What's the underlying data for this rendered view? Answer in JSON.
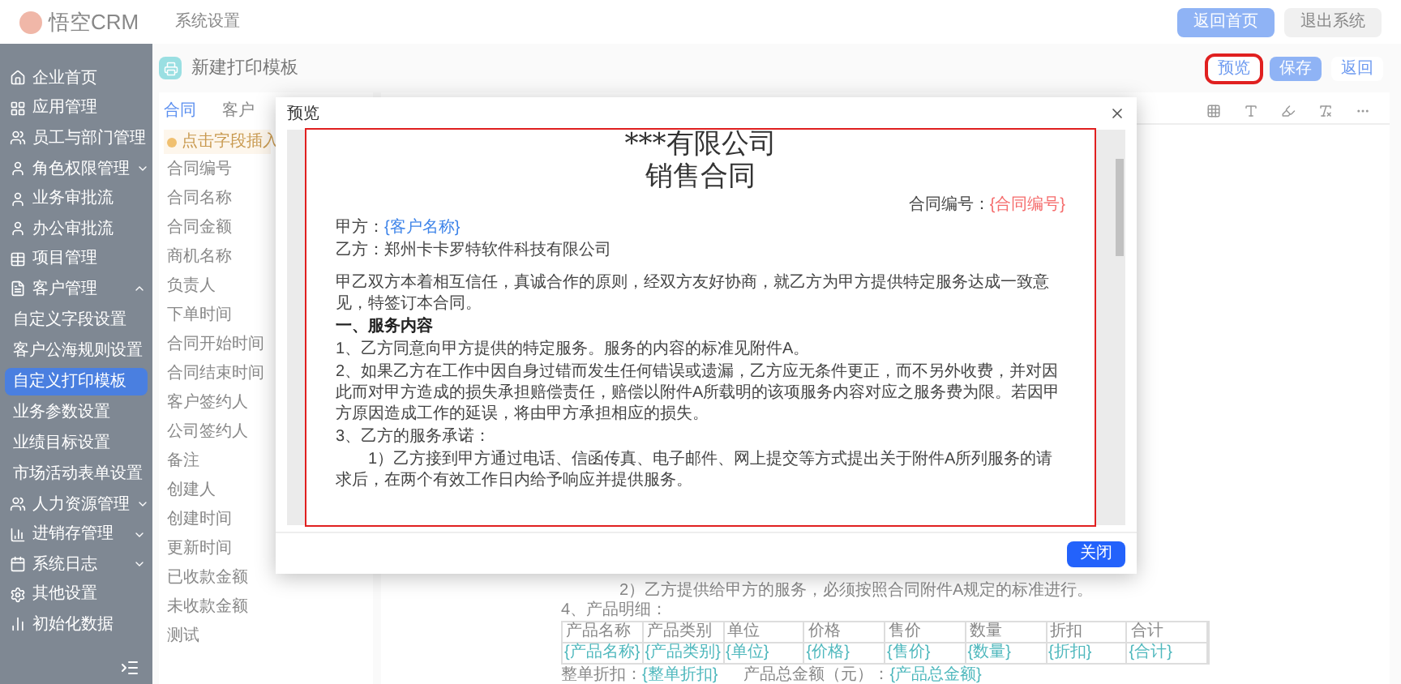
{
  "header": {
    "logo": "悟空CRM",
    "nav": "系统设置",
    "buttons": [
      {
        "label": "返回首页",
        "kind": "primary"
      },
      {
        "label": "退出系统",
        "kind": "default"
      }
    ]
  },
  "sidebar": {
    "items": [
      {
        "label": "企业首页"
      },
      {
        "label": "应用管理"
      },
      {
        "label": "员工与部门管理"
      },
      {
        "label": "角色权限管理",
        "expanded": false
      },
      {
        "label": "业务审批流"
      },
      {
        "label": "办公审批流"
      },
      {
        "label": "项目管理"
      },
      {
        "label": "客户管理",
        "expanded": true,
        "children": [
          {
            "label": "自定义字段设置",
            "selected": false
          },
          {
            "label": "客户公海规则设置",
            "selected": false
          },
          {
            "label": "自定义打印模板",
            "selected": true
          },
          {
            "label": "业务参数设置",
            "selected": false
          },
          {
            "label": "业绩目标设置",
            "selected": false
          },
          {
            "label": "市场活动表单设置",
            "selected": false
          }
        ]
      },
      {
        "label": "人力资源管理",
        "expanded": false
      },
      {
        "label": "进销存管理",
        "expanded": false
      },
      {
        "label": "系统日志",
        "expanded": false
      },
      {
        "label": "其他设置"
      },
      {
        "label": "初始化数据"
      }
    ]
  },
  "page": {
    "title": "新建打印模板",
    "buttons": [
      {
        "label": "预览",
        "kind": "default",
        "highlighted": true
      },
      {
        "label": "保存",
        "kind": "primary",
        "highlighted": false
      },
      {
        "label": "返回",
        "kind": "default",
        "highlighted": false
      }
    ]
  },
  "field_panel": {
    "tabs": [
      {
        "label": "合同",
        "selected": true
      },
      {
        "label": "客户",
        "selected": false
      }
    ],
    "hint": "点击字段插入",
    "fields": [
      "合同编号",
      "合同名称",
      "合同金额",
      "商机名称",
      "负责人",
      "下单时间",
      "合同开始时间",
      "合同结束时间",
      "客户签约人",
      "公司签约人",
      "备注",
      "创建人",
      "创建时间",
      "更新时间",
      "已收款金额",
      "未收款金额",
      "测试"
    ]
  },
  "editor": {
    "lines": [
      {
        "kind": "indent",
        "text": "2）乙方提供给甲方的服务，必须按照合同附件A规定的标准进行。"
      },
      {
        "kind": "plain",
        "text": "4、产品明细："
      }
    ],
    "table": {
      "columns": [
        "产品名称",
        "产品类别",
        "单位",
        "价格",
        "售价",
        "数量",
        "折扣",
        "合计"
      ],
      "row": [
        "{产品名称}",
        "{产品类别}",
        "{单位}",
        "{价格}",
        "{售价}",
        "{数量}",
        "{折扣}",
        "{合计}"
      ]
    },
    "totals": [
      {
        "label": "整单折扣：",
        "value": "{整单折扣}"
      },
      {
        "label": "产品总金额（元）：",
        "value": "{产品总金额}"
      }
    ]
  },
  "preview": {
    "title": "预览",
    "paper_highlighted": true,
    "lines": [
      {
        "kind": "title",
        "text": "***有限公司"
      },
      {
        "kind": "title",
        "text": "销售合同"
      },
      {
        "kind": "ref",
        "label": "合同编号：",
        "value": "{合同编号}",
        "color": "#f56c6c"
      },
      {
        "kind": "field",
        "label": "甲方：",
        "value": "{客户名称}",
        "color": "#3e84e9"
      },
      {
        "kind": "plain",
        "text": "乙方：郑州卡卡罗特软件科技有限公司"
      },
      {
        "kind": "para",
        "text": "甲乙双方本着相互信任，真诚合作的原则，经双方友好协商，就乙方为甲方提供特定服务达成一致意见，特签订本合同。"
      },
      {
        "kind": "heading",
        "text": "一、服务内容"
      },
      {
        "kind": "plain",
        "text": "1、乙方同意向甲方提供的特定服务。服务的内容的标准见附件A。"
      },
      {
        "kind": "plain",
        "text": "2、如果乙方在工作中因自身过错而发生任何错误或遗漏，乙方应无条件更正，而不另外收费，并对因此而对甲方造成的损失承担赔偿责任，赔偿以附件A所载明的该项服务内容对应之服务费为限。若因甲方原因造成工作的延误，将由甲方承担相应的损失。"
      },
      {
        "kind": "plain",
        "text": "3、乙方的服务承诺："
      },
      {
        "kind": "indent",
        "text": "1）乙方接到甲方通过电话、信函传真、电子邮件、网上提交等方式提出关于附件A所列服务的请求后，在两个有效工作日内给予响应并提供服务。"
      }
    ],
    "close_button": "关闭"
  }
}
